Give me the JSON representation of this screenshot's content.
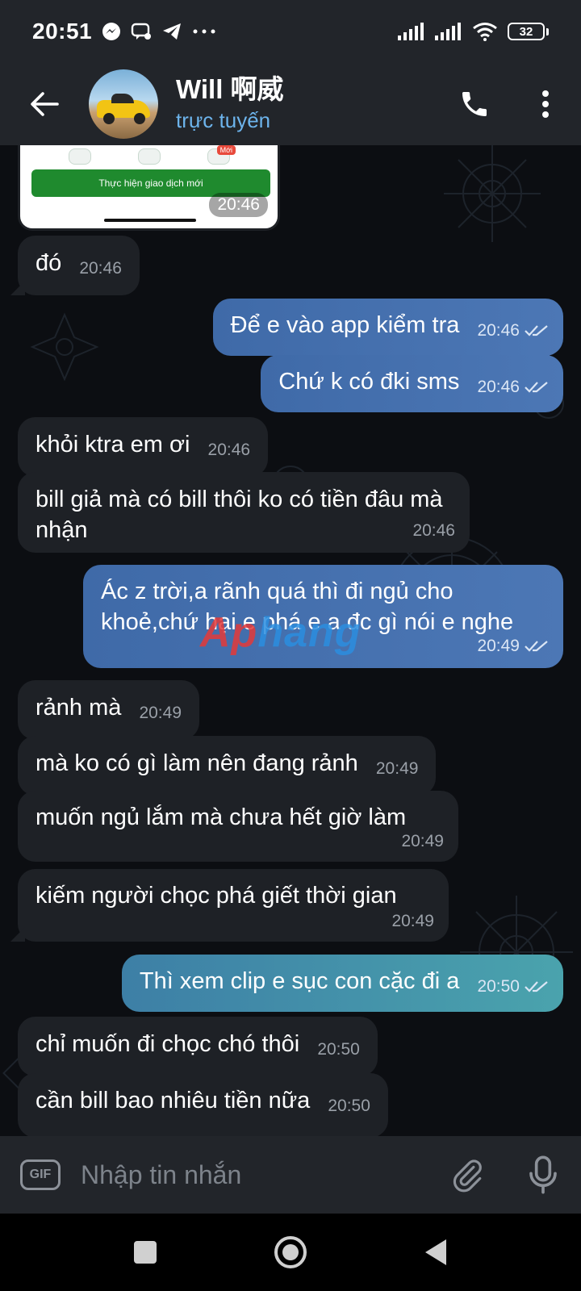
{
  "status_bar": {
    "time": "20:51",
    "battery": "32",
    "notification_icons": [
      "messenger-icon",
      "chat-icon",
      "telegram-icon",
      "more-dots-icon"
    ],
    "system_icons": [
      "signal-icon",
      "signal-icon",
      "wifi-icon",
      "battery-icon"
    ]
  },
  "header": {
    "name": "Will 啊威",
    "status": "trực tuyến",
    "status_color": "#6db4ec",
    "icons": [
      "back-arrow-icon",
      "phone-icon",
      "more-vertical-icon"
    ]
  },
  "image_message": {
    "button_label": "Thực hiện giao dịch mới",
    "badge": "Mới",
    "time": "20:46"
  },
  "messages": [
    {
      "dir": "in",
      "text": "đó",
      "time": "20:46"
    },
    {
      "dir": "out",
      "text": "Để e vào app kiểm tra",
      "time": "20:46"
    },
    {
      "dir": "out",
      "text": "Chứ k có đki sms",
      "time": "20:46"
    },
    {
      "dir": "in",
      "text": "khỏi ktra em ơi",
      "time": "20:46"
    },
    {
      "dir": "in",
      "text": "bill giả mà có bill thôi ko có tiền đâu mà nhận",
      "time": "20:46"
    },
    {
      "dir": "out",
      "text": "Ác z trời,a rãnh quá thì đi ngủ cho khoẻ,chứ hại e phá e a đc gì nói e nghe",
      "time": "20:49"
    },
    {
      "dir": "in",
      "text": "rảnh mà",
      "time": "20:49"
    },
    {
      "dir": "in",
      "text": "mà ko có gì làm nên đang rảnh",
      "time": "20:49"
    },
    {
      "dir": "in",
      "text": "muốn ngủ lắm mà chưa hết giờ làm",
      "time": "20:49"
    },
    {
      "dir": "in",
      "text": "kiếm người chọc phá giết thời gian",
      "time": "20:49"
    },
    {
      "dir": "out",
      "text": "Thì xem clip e sục con cặc đi a",
      "time": "20:50"
    },
    {
      "dir": "in",
      "text": "chỉ muốn đi chọc chó thôi",
      "time": "20:50"
    },
    {
      "dir": "in",
      "text": "cần bill bao nhiêu tiền nữa",
      "time": "20:50"
    }
  ],
  "watermark": {
    "part1": "Ap",
    "part2": "hang"
  },
  "input": {
    "gif_label": "GIF",
    "placeholder": "Nhập tin nhắn",
    "icons": [
      "gif-icon",
      "paperclip-icon",
      "microphone-icon"
    ]
  },
  "nav": {
    "icons": [
      "recents-square-icon",
      "home-circle-icon",
      "back-triangle-icon"
    ]
  },
  "colors": {
    "bar_background": "#22252a",
    "incoming_bubble": "#1e2126",
    "outgoing_bubble": "#4c77b5",
    "outgoing_bubble_teal": "#4aa3ad"
  }
}
